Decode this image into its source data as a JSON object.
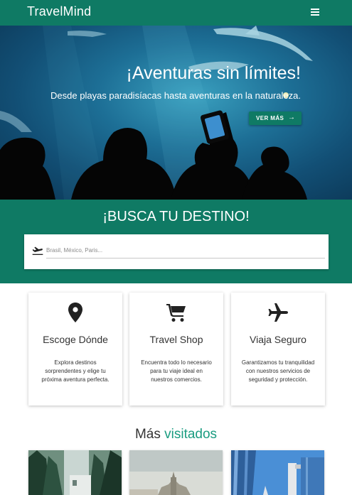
{
  "navbar": {
    "brand": "TravelMind",
    "menu_icon": "hamburger-menu-icon"
  },
  "hero": {
    "title": "¡Aventuras sin límites!",
    "subtitle": "Desde playas paradisíacas hasta aventuras en la naturaleza.",
    "button_label": "VER MÁS",
    "button_icon": "arrow-right-icon"
  },
  "search": {
    "title": "¡BUSCA TU DESTINO!",
    "placeholder": "Brasil, México, Paris...",
    "icon": "flight-takeoff-icon"
  },
  "features": [
    {
      "icon": "location-pin-icon",
      "title": "Escoge Dónde",
      "description": "Explora destinos sorprendentes y elige tu próxima aventura perfecta."
    },
    {
      "icon": "shopping-cart-icon",
      "title": "Travel Shop",
      "description": "Encuentra todo lo necesario para tu viaje ideal en nuestros comercios."
    },
    {
      "icon": "airplane-icon",
      "title": "Viaja Seguro",
      "description": "Garantizamos tu tranquilidad con nuestros servicios de seguridad y protección."
    }
  ],
  "most_visited": {
    "title_part1": "Más",
    "title_part2": "visitados"
  },
  "colors": {
    "primary": "#0f7a64",
    "accent": "#1a9c80",
    "text": "#333333"
  }
}
